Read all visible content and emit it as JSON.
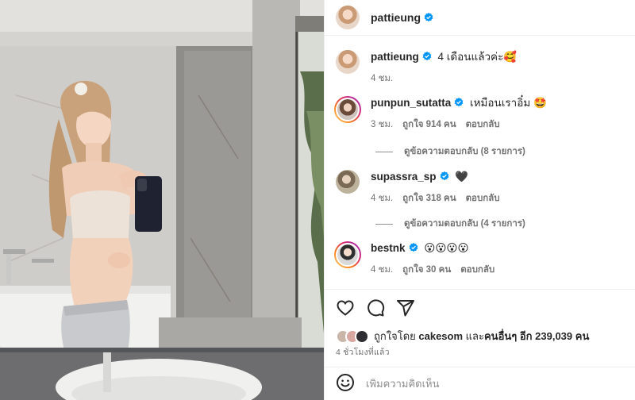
{
  "post": {
    "author": "pattieung",
    "caption": "4 เดือนแล้วค่ะ🥰",
    "caption_time": "4 ชม."
  },
  "comments": [
    {
      "username": "punpun_sutatta",
      "text": "เหมือนเราอิ๋ม 🤩",
      "time": "3 ชม.",
      "likes": "ถูกใจ 914 คน",
      "reply": "ตอบกลับ",
      "view_replies": "ดูข้อความตอบกลับ (8 รายการ)"
    },
    {
      "username": "supassra_sp",
      "text": "🖤",
      "time": "4 ชม.",
      "likes": "ถูกใจ 318 คน",
      "reply": "ตอบกลับ",
      "view_replies": "ดูข้อความตอบกลับ (4 รายการ)"
    },
    {
      "username": "bestnk",
      "text": "😮😮😮😮",
      "time": "4 ชม.",
      "likes": "ถูกใจ 30 คน",
      "reply": "ตอบกลับ"
    }
  ],
  "actions": {
    "like_icon": "heart-icon",
    "comment_icon": "comment-icon",
    "share_icon": "share-icon"
  },
  "likes": {
    "prefix": "ถูกใจโดย",
    "user": "cakesom",
    "middle": "และ",
    "others": "คนอื่นๆ อีก 239,039 คน"
  },
  "posted_time": "4 ชั่วโมงที่แล้ว",
  "add_comment": {
    "placeholder": "เพิ่มความคิดเห็น",
    "emoji_icon": "smiley-icon"
  },
  "colors": {
    "verified": "#0095f6",
    "secondary_text": "#737373",
    "divider": "#efefef"
  }
}
